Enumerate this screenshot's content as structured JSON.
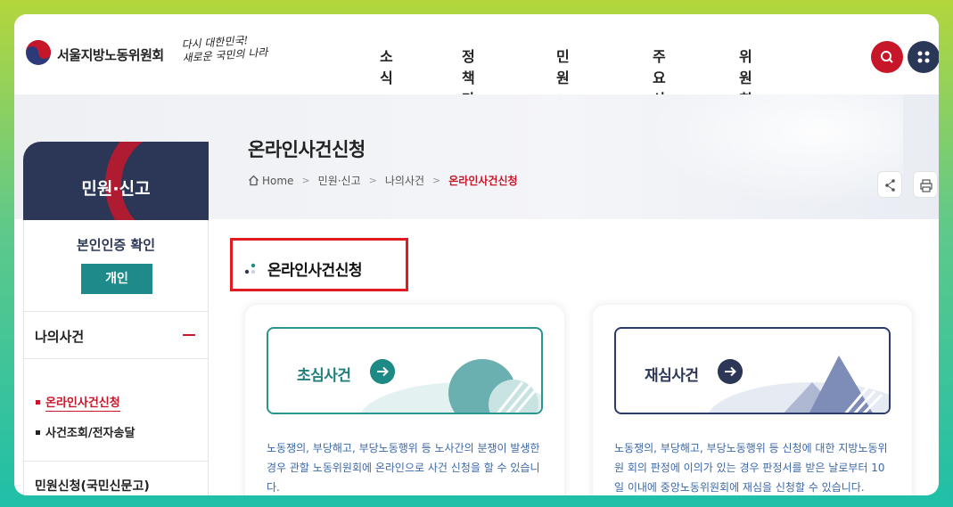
{
  "header": {
    "org_name": "서울지방노동위원회",
    "slogan_line1": "다시 대한민국!",
    "slogan_line2": "새로운 국민의 나라",
    "nav": [
      "소식",
      "정책마당",
      "민원·신고",
      "주요사례",
      "위원회소개"
    ],
    "search_icon": "search-icon",
    "menu_icon": "grid-menu-icon"
  },
  "sidebar": {
    "title": "민원·신고",
    "auth_label": "본인인증 확인",
    "auth_button": "개인",
    "menu_mycase": "나의사건",
    "submenu": [
      "온라인사건신청",
      "사건조회/전자송달"
    ],
    "menu_petition": "민원신청(국민신문고)"
  },
  "page": {
    "title": "온라인사건신청",
    "breadcrumb": {
      "home": "Home",
      "items": [
        "민원·신고",
        "나의사건"
      ],
      "current": "온라인사건신청"
    },
    "section_title": "온라인사건신청"
  },
  "cards": [
    {
      "label": "초심사건",
      "desc": "노동쟁의, 부당해고, 부당노동행위 등 노사간의 분쟁이 발생한 경우 관할 노동위원회에 온라인으로 사건 신청을 할 수 있습니다."
    },
    {
      "label": "재심사건",
      "desc": "노동쟁의, 부당해고, 부당노동행위 등 신청에 대한 지방노동위원 회의 판정에 이의가 있는 경우 판정서를 받은 날로부터 10일 이내에 중앙노동위원회에 재심을 신청할 수 있습니다."
    }
  ],
  "colors": {
    "accent_red": "#c7162a",
    "navy": "#2c3656",
    "teal": "#1e8a8a",
    "outer_gradient_top": "#b4d63c",
    "outer_gradient_bottom": "#1fbfa8"
  }
}
